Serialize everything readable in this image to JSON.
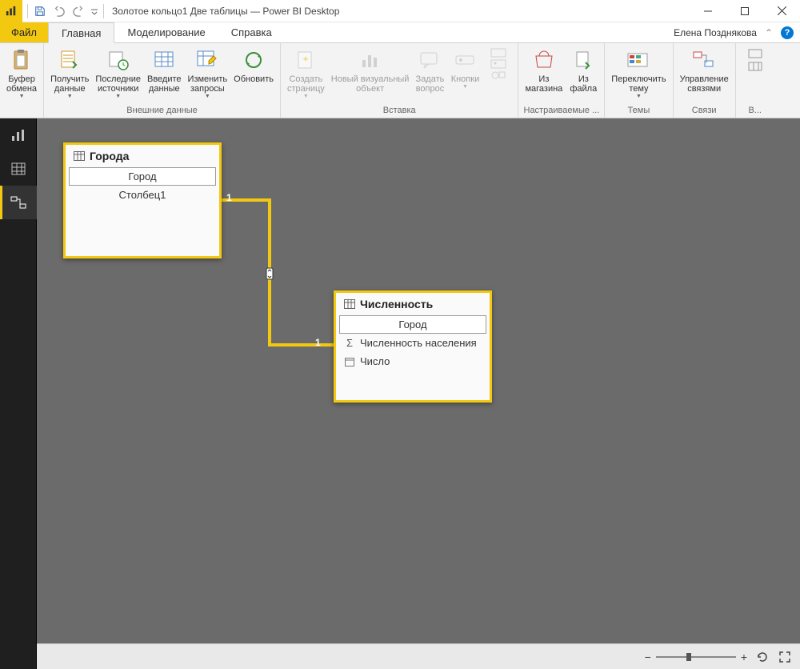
{
  "title": "Золотое кольцо1 Две таблицы — Power BI Desktop",
  "user": "Елена Позднякова",
  "tabs": {
    "file": "Файл",
    "home": "Главная",
    "modeling": "Моделирование",
    "help": "Справка"
  },
  "ribbon": {
    "clipboard": {
      "paste": "Буфер\nобмена",
      "label": ""
    },
    "external": {
      "get": "Получить\nданные",
      "recent": "Последние\nисточники",
      "enter": "Введите\nданные",
      "edit": "Изменить\nзапросы",
      "refresh": "Обновить",
      "label": "Внешние данные"
    },
    "insert": {
      "page": "Создать\nстраницу",
      "visual": "Новый визуальный\nобъект",
      "ask": "Задать\nвопрос",
      "buttons": "Кнопки",
      "label": "Вставка"
    },
    "custom": {
      "store": "Из\nмагазина",
      "file": "Из\nфайла",
      "label": "Настраиваемые ..."
    },
    "themes": {
      "switch": "Переключить\nтему",
      "label": "Темы"
    },
    "relations": {
      "manage": "Управление\nсвязями",
      "label": "Связи"
    },
    "calc": {
      "label": "В..."
    }
  },
  "tables": {
    "t1": {
      "name": "Города",
      "fields": [
        "Город",
        "Столбец1"
      ]
    },
    "t2": {
      "name": "Численность",
      "fields": [
        "Город",
        "Численность населения",
        "Число"
      ]
    }
  },
  "rel": {
    "left": "1",
    "right": "1"
  }
}
